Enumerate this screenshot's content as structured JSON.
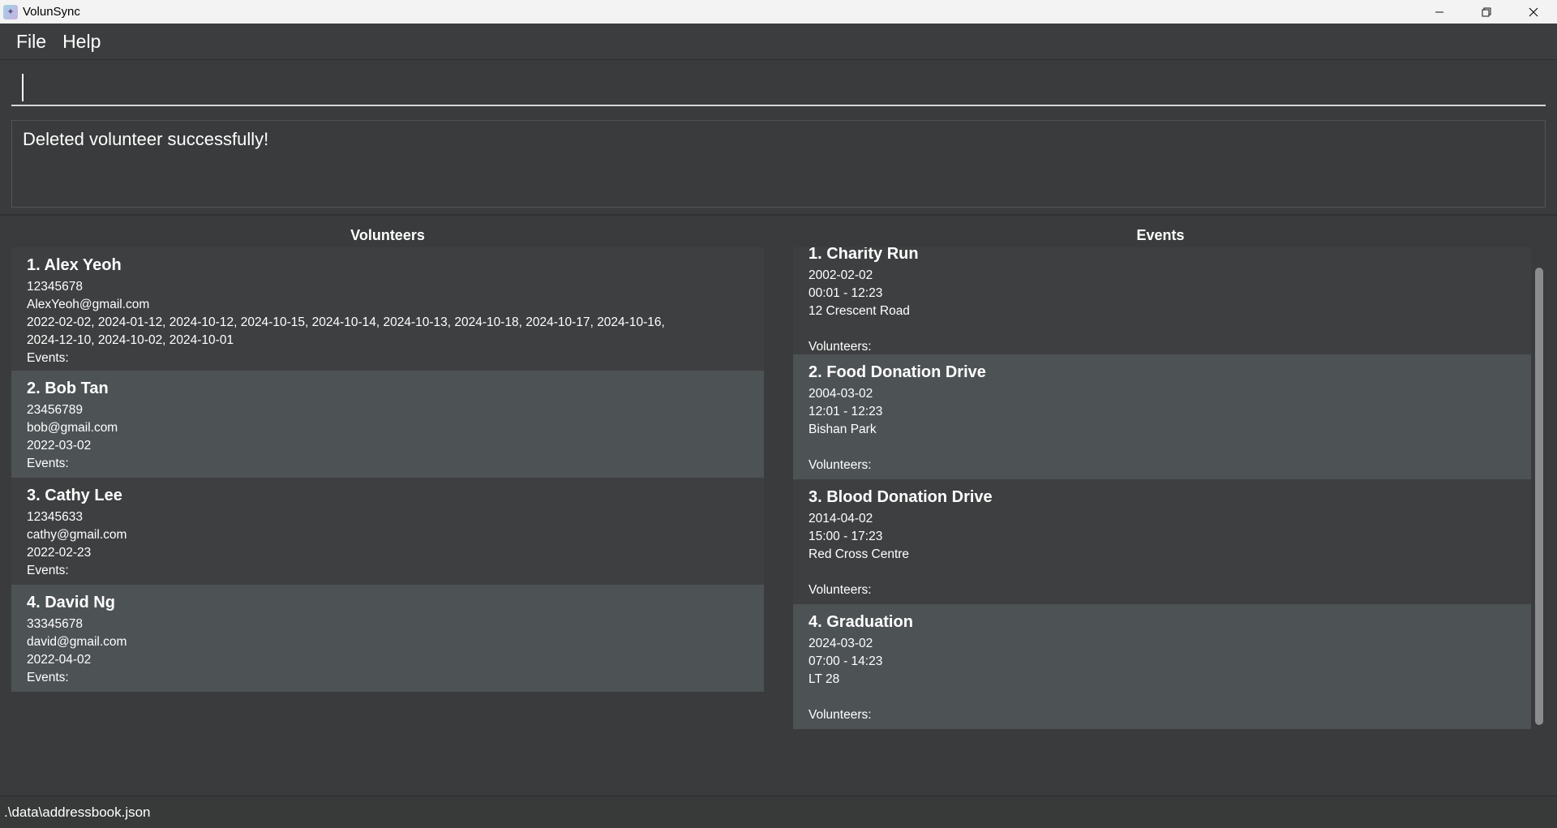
{
  "window": {
    "title": "VolunSync",
    "minimize": "—",
    "restore": "❐",
    "close": "✕"
  },
  "menu": {
    "file": "File",
    "help": "Help"
  },
  "command": {
    "value": "",
    "placeholder": ""
  },
  "result": {
    "message": "Deleted volunteer successfully!"
  },
  "volunteers": {
    "heading": "Volunteers",
    "items": [
      {
        "title": "1. Alex Yeoh",
        "phone": "12345678",
        "email": "AlexYeoh@gmail.com",
        "dates": "2022-02-02, 2024-01-12, 2024-10-12, 2024-10-15, 2024-10-14, 2024-10-13, 2024-10-18, 2024-10-17, 2024-10-16,",
        "dates2": "2024-12-10, 2024-10-02, 2024-10-01",
        "events": "Events:"
      },
      {
        "title": "2. Bob Tan",
        "phone": "23456789",
        "email": "bob@gmail.com",
        "dates": "2022-03-02",
        "events": "Events:"
      },
      {
        "title": "3. Cathy Lee",
        "phone": "12345633",
        "email": "cathy@gmail.com",
        "dates": "2022-02-23",
        "events": "Events:"
      },
      {
        "title": "4. David Ng",
        "phone": "33345678",
        "email": "david@gmail.com",
        "dates": "2022-04-02",
        "events": "Events:"
      }
    ]
  },
  "events": {
    "heading": "Events",
    "items": [
      {
        "title": "1. Charity Run",
        "date": "2002-02-02",
        "time": "00:01 - 12:23",
        "location": "12 Crescent Road",
        "volunteers": "Volunteers:"
      },
      {
        "title": "2. Food Donation Drive",
        "date": "2004-03-02",
        "time": "12:01 - 12:23",
        "location": "Bishan Park",
        "volunteers": "Volunteers:"
      },
      {
        "title": "3. Blood Donation Drive",
        "date": "2014-04-02",
        "time": "15:00 - 17:23",
        "location": "Red Cross Centre",
        "volunteers": "Volunteers:"
      },
      {
        "title": "4. Graduation",
        "date": "2024-03-02",
        "time": "07:00 - 14:23",
        "location": "LT 28",
        "volunteers": "Volunteers:"
      }
    ]
  },
  "status": {
    "path": ".\\data\\addressbook.json"
  },
  "colors": {
    "background": "#3a3b3c",
    "card_odd": "#3e3f40",
    "card_even": "#4d5255"
  }
}
